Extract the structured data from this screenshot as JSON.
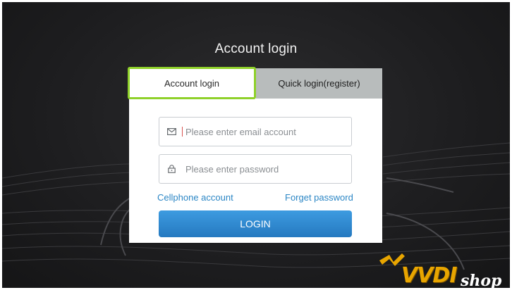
{
  "page": {
    "title": "Account login"
  },
  "tabs": {
    "account_login": "Account login",
    "quick_login": "Quick login(register)"
  },
  "form": {
    "email_placeholder": "Please enter email account",
    "password_placeholder": "Please enter password",
    "cellphone_link": "Cellphone account",
    "forget_link": "Forget password",
    "login_button": "LOGIN"
  },
  "watermark": {
    "brand": "VVDI",
    "suffix": "shop"
  },
  "colors": {
    "active_tab_border": "#8fd12a",
    "link": "#2b86c5",
    "button": "#2d86d0",
    "watermark": "#e8a500"
  },
  "icons": {
    "email": "mail-icon",
    "password": "lock-icon"
  }
}
